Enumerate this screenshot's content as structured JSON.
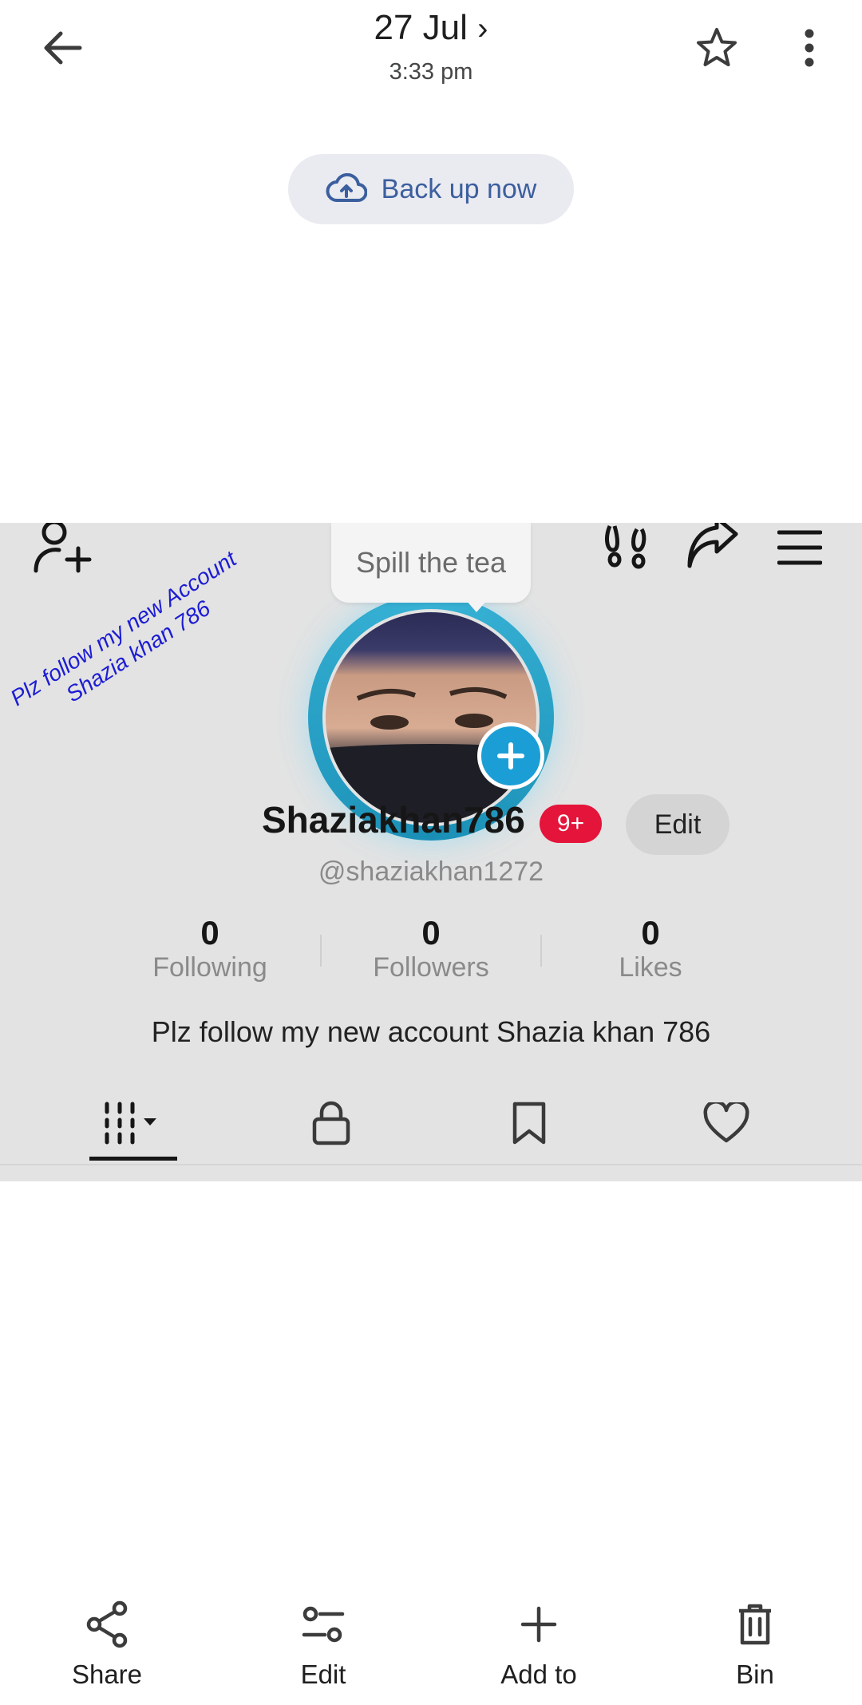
{
  "header": {
    "date": "27 Jul",
    "date_chevron": "›",
    "time": "3:33 pm"
  },
  "backup": {
    "label": "Back up now"
  },
  "photo": {
    "tooltip": "Spill the tea",
    "watermark_line1": "Plz follow my new Account",
    "watermark_line2": "Shazia khan 786",
    "username": "Shaziakhan786",
    "notification_badge": "9+",
    "edit_label": "Edit",
    "handle": "@shaziakhan1272",
    "stats": [
      {
        "value": "0",
        "label": "Following"
      },
      {
        "value": "0",
        "label": "Followers"
      },
      {
        "value": "0",
        "label": "Likes"
      }
    ],
    "bio": "Plz follow my new account Shazia khan 786",
    "tabs": [
      "videos-grid-icon",
      "lock-icon",
      "bookmark-icon",
      "heart-icon"
    ]
  },
  "actions": [
    {
      "label": "Share",
      "icon": "share-icon"
    },
    {
      "label": "Edit",
      "icon": "edit-sliders-icon"
    },
    {
      "label": "Add to",
      "icon": "plus-icon"
    },
    {
      "label": "Bin",
      "icon": "trash-icon"
    }
  ],
  "colors": {
    "accent": "#3b5f9e",
    "tiktok_ring": "#1b9ed6",
    "badge_red": "#e4143a",
    "watermark": "#1c1cd4"
  }
}
